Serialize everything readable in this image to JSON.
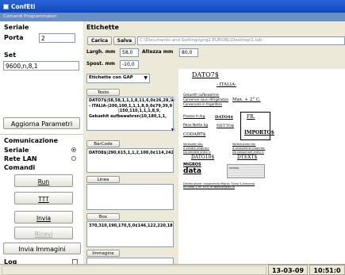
{
  "window": {
    "title": "ConfEti",
    "menu": "Comandi  Programmatori"
  },
  "left": {
    "seriale_header": "Seriale",
    "porta_label": "Porta",
    "porta_value": "2",
    "set_label": "Set",
    "set_value": "9600,n,8,1",
    "aggiorna_button": "Aggiorna Parametri",
    "comunicazione_header": "Comunicazione",
    "seriale_radio": "Seriale",
    "rete_radio": "Rete LAN",
    "comandi_header": "Comandi",
    "run_button": "Run",
    "ttt_button": "TTT",
    "invia_button": "Invia",
    "ricevi_button": "Ricevi",
    "invia_immagini_button": "Invia Immagini",
    "log_label": "Log"
  },
  "etichette": {
    "header": "Etichette",
    "carica_button": "Carica",
    "salva_button": "Salva",
    "path": "C:\\Documents and Settings\\prg2.EUROBL\\Desktop\\1.lab",
    "larg_label": "Largh. mm",
    "larg_value": "58,0",
    "altezza_label": "Altezza mm",
    "altezza_value": "80,0",
    "spost_label": "Spost. mm",
    "spost_value": "-10,0",
    "gap_select": "Etichette con GAP",
    "testo_button": "Testo",
    "testo_lines": [
      "DATO7$|58,58,1,1,1,8,11,6,0¢26,28,76,",
      "- ITALIA-|200,100,1,1,1,8,9,0¢79,39,9",
      "|150,110,1,1,1,8,9,",
      "Gekuehlt aufbewahren|10,180,1,1,"
    ],
    "barcode_button": "BarCode",
    "barcode_line": "DATO8$|290,615,1,1,2,100,0¢114,242,23",
    "linea_button": "Linea",
    "box_button": "Box",
    "box_line": "370,310,190,170,5,0¢146,122,220,189",
    "immagine_button": "Immagine"
  },
  "preview": {
    "dato7": "DATO7$",
    "italia": "- ITALIA-",
    "aufbewahren": "Gekuehlt aufbewahren",
    "conservare": "Conserver sous réfrigération",
    "conservare2": "Conservare in frigorifero",
    "max": "Max. + 2° C.",
    "prezzo_label": "Prezzo fr./kg",
    "dato4": "DATO4$",
    "fr": "FR.",
    "peso_label": "Peso Netto kg",
    "netto": "NETTO$",
    "importo": "IMPORTO$",
    "codart": "CODART$",
    "verkaufen": "Verkaufen bis:",
    "avendre": "A vendre jusqu'au:",
    "davendere": "Da vendere entro il:",
    "verbrauchen": "Verbrauchen bis:",
    "aconsommer": "A consommer jusqu'au:",
    "daconsumare": "Da consumare entro il:",
    "dato10": "DATO10$",
    "dtext": "DTEXT$",
    "migros": "MIGROS",
    "data": "data",
    "dato9": "DATO9$",
    "footer": "Distribuzione: cooperativa Migros Ticino S.Antonino",
    "footer2": "M.Gross 1,90 1001 m    www.migros.ch"
  },
  "status": {
    "date": "13-03-09",
    "time": "10:51:0"
  }
}
